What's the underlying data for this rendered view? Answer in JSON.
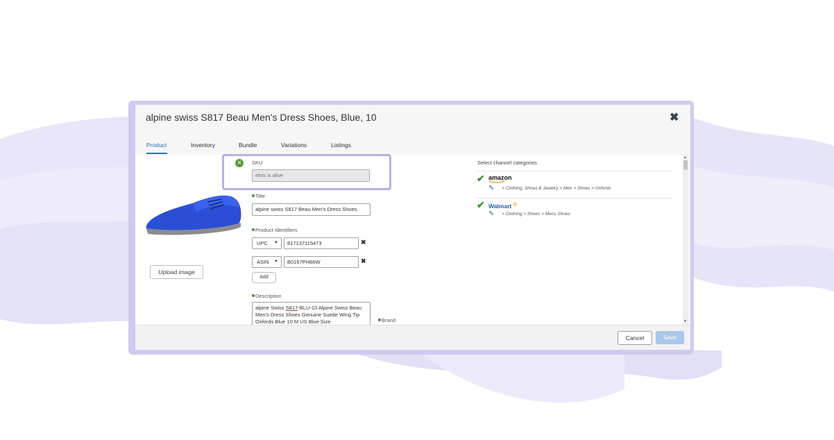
{
  "modal": {
    "title": "alpine swiss S817 Beau Men's Dress Shoes, Blue, 10",
    "close_icon": "close-icon"
  },
  "tabs": [
    {
      "label": "Product",
      "active": true
    },
    {
      "label": "Inventory"
    },
    {
      "label": "Bundle"
    },
    {
      "label": "Variations"
    },
    {
      "label": "Listings"
    }
  ],
  "product": {
    "upload_label": "Upload image",
    "sku": {
      "label": "SKU",
      "value": "elvis is alive"
    },
    "title": {
      "label": "Title",
      "value": "alpine swiss S817 Beau Men's Dress Shoes."
    },
    "identifiers": {
      "label": "Product Identifiers",
      "rows": [
        {
          "type": "UPC",
          "value": "817137115473"
        },
        {
          "type": "ASIN",
          "value": "B0167PH66W"
        }
      ],
      "add_label": "Add"
    },
    "description": {
      "label": "Description",
      "value_pre": "alpine Swiss ",
      "value_sku": "S817",
      "value_post": "-BLU-10 Alpine Swiss Beau Men's Dress Shoes Genuine Suede Wing Tip Oxfords Blue 10 M US Blue Size"
    },
    "brand_label": "Brand"
  },
  "channels": {
    "title": "Select channel categories",
    "items": [
      {
        "name": "amazon",
        "path": "> Clothing, Shoes & Jewelry > Men > Shoes > Oxfords"
      },
      {
        "name": "Walmart",
        "path": "> Clothing > Shoes > Mens Shoes"
      }
    ]
  },
  "footer": {
    "cancel_label": "Cancel",
    "save_label": "Save"
  },
  "colors": {
    "accent": "#2d6fb3",
    "highlight_border": "#b8b0e8",
    "save_disabled": "#a9c8ea",
    "check": "#3f8f3b"
  }
}
